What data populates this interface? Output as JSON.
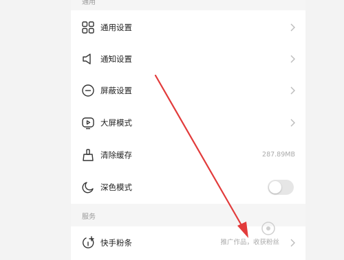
{
  "sections": {
    "general_header": "通用",
    "services_header": "服务"
  },
  "general": {
    "items": [
      {
        "label": "通用设置",
        "icon": "grid-icon"
      },
      {
        "label": "通知设置",
        "icon": "speaker-icon"
      },
      {
        "label": "屏蔽设置",
        "icon": "block-icon"
      },
      {
        "label": "大屏模式",
        "icon": "play-screen-icon"
      },
      {
        "label": "清除缓存",
        "icon": "broom-icon",
        "value": "287.89MB"
      },
      {
        "label": "深色模式",
        "icon": "moon-icon",
        "toggle_on": false
      }
    ]
  },
  "services": {
    "items": [
      {
        "label": "快手粉条",
        "icon": "boost-icon",
        "value": "推广作品，收获粉丝"
      }
    ]
  },
  "colors": {
    "annotation_arrow": "#e23b3b",
    "background": "#f5f5f5",
    "card": "#ffffff"
  }
}
